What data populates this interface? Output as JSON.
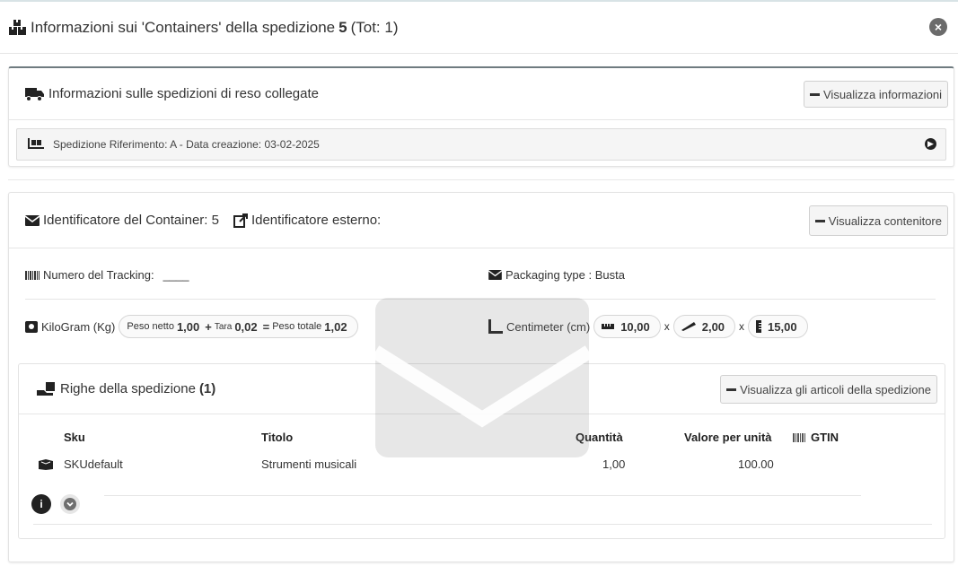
{
  "header": {
    "title_prefix": "Informazioni sui 'Containers' della spedizione",
    "shipment_number": "5",
    "title_suffix": "(Tot: 1)"
  },
  "return_panel": {
    "title": "Informazioni sulle spedizioni di reso collegate",
    "toggle_label": "Visualizza informazioni",
    "reference_text": "Spedizione Riferimento: A - Data creazione: 03-02-2025"
  },
  "container_panel": {
    "identifier_label": "Identificatore del Container: 5",
    "external_label": "Identificatore esterno:",
    "toggle_label": "Visualizza contenitore",
    "tracking_label": "Numero del Tracking:",
    "tracking_value": "____",
    "packaging_label": "Packaging type : Busta",
    "weight_label": "KiloGram (Kg)",
    "weight_net_label": "Peso netto",
    "weight_net_value": "1,00",
    "weight_plus": "+",
    "weight_tare_label": "Tara",
    "weight_tare_value": "0,02",
    "weight_equals": "=",
    "weight_total_label": "Peso totale",
    "weight_total_value": "1,02",
    "dimension_label": "Centimeter (cm)",
    "dim_length": "10,00",
    "dim_width": "2,00",
    "dim_height": "15,00",
    "dim_sep": "x"
  },
  "lines_panel": {
    "title": "Righe della spedizione",
    "count": "(1)",
    "toggle_label": "Visualizza gli articoli della spedizione",
    "columns": {
      "sku": "Sku",
      "title": "Titolo",
      "quantity": "Quantità",
      "unit_value": "Valore per unità",
      "gtin": "GTIN"
    },
    "rows": [
      {
        "sku": "SKUdefault",
        "title": "Strumenti musicali",
        "quantity": "1,00",
        "unit_value": "100.00",
        "gtin": ""
      }
    ]
  }
}
